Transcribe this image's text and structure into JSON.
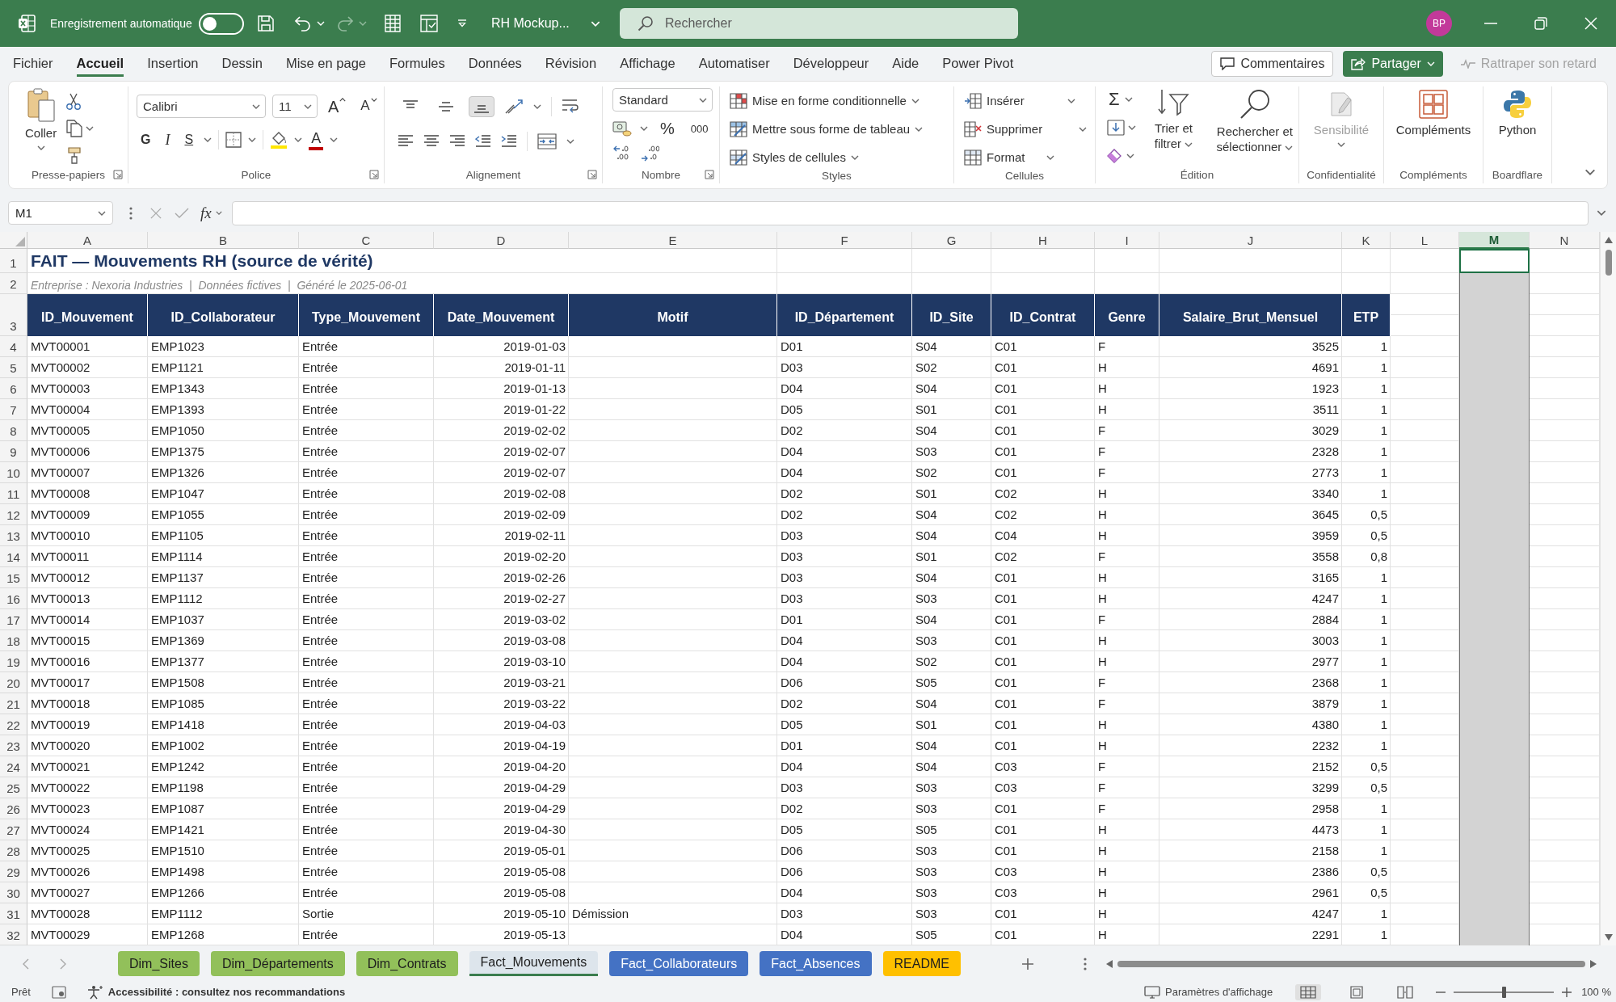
{
  "window": {
    "autosave_label": "Enregistrement automatique",
    "autosave_on": false,
    "redo_disabled": true,
    "title": "RH Mockup...",
    "search_placeholder": "Rechercher",
    "avatar": "BP"
  },
  "menu_tabs": [
    {
      "label": "Fichier",
      "selected": false
    },
    {
      "label": "Accueil",
      "selected": true
    },
    {
      "label": "Insertion",
      "selected": false
    },
    {
      "label": "Dessin",
      "selected": false
    },
    {
      "label": "Mise en page",
      "selected": false
    },
    {
      "label": "Formules",
      "selected": false
    },
    {
      "label": "Données",
      "selected": false
    },
    {
      "label": "Révision",
      "selected": false
    },
    {
      "label": "Affichage",
      "selected": false
    },
    {
      "label": "Automatiser",
      "selected": false
    },
    {
      "label": "Développeur",
      "selected": false
    },
    {
      "label": "Aide",
      "selected": false
    },
    {
      "label": "Power Pivot",
      "selected": false
    }
  ],
  "header_buttons": [
    {
      "kind": "comments",
      "label": "Commentaires",
      "disabled": false
    },
    {
      "kind": "share",
      "label": "Partager",
      "disabled": false
    },
    {
      "kind": "catchup",
      "label": "Rattraper son retard",
      "disabled": true
    }
  ],
  "ribbon": {
    "groups": [
      {
        "label": "Presse-papiers",
        "paste": "Coller"
      },
      {
        "label": "Police",
        "font": "Calibri",
        "size": "11",
        "grow": "A",
        "shrink": "A",
        "bold": "G",
        "italic": "I",
        "underline": "S",
        "font_color": "A"
      },
      {
        "label": "Alignement",
        "vertical_align": [
          {
            "kind": "top",
            "selected": false
          },
          {
            "kind": "middle",
            "selected": false
          },
          {
            "kind": "bottom",
            "selected": true
          }
        ]
      },
      {
        "label": "Nombre",
        "format": "Standard",
        "percent": "%",
        "thousands": "000"
      },
      {
        "label": "Styles",
        "items": [
          "Mise en forme conditionnelle",
          "Mettre sous forme de tableau",
          "Styles de cellules"
        ]
      },
      {
        "label": "Cellules",
        "items": [
          "Insérer",
          "Supprimer",
          "Format"
        ]
      },
      {
        "label": "Édition",
        "sum": "Σ",
        "sort": "Trier et filtrer",
        "find": "Rechercher et sélectionner"
      },
      {
        "label": "Confidentialité",
        "button": "Sensibilité",
        "disabled": true
      },
      {
        "label": "Compléments",
        "button": "Compléments"
      },
      {
        "label": "Boardflare",
        "button": "Python"
      }
    ]
  },
  "formula_bar": {
    "name_box": "M1",
    "fx": "fx"
  },
  "sheet": {
    "columns": [
      {
        "letter": "A",
        "selected": false
      },
      {
        "letter": "B",
        "selected": false
      },
      {
        "letter": "C",
        "selected": false
      },
      {
        "letter": "D",
        "selected": false
      },
      {
        "letter": "E",
        "selected": false
      },
      {
        "letter": "F",
        "selected": false
      },
      {
        "letter": "G",
        "selected": false
      },
      {
        "letter": "H",
        "selected": false
      },
      {
        "letter": "I",
        "selected": false
      },
      {
        "letter": "J",
        "selected": false
      },
      {
        "letter": "K",
        "selected": false
      },
      {
        "letter": "L",
        "selected": false
      },
      {
        "letter": "M",
        "selected": true
      },
      {
        "letter": "N",
        "selected": false
      }
    ],
    "rows": [
      {
        "number": "1",
        "kind": "title",
        "text": "FAIT — Mouvements RH (source de vérité)"
      },
      {
        "number": "2",
        "kind": "subtitle",
        "text": "Entreprise : Nexoria Industries  |  Données fictives  |  Généré le 2025-06-01"
      },
      {
        "number": "3",
        "kind": "header",
        "cells": [
          "ID_Mouvement",
          "ID_Collaborateur",
          "Type_Mouvement",
          "Date_Mouvement",
          "Motif",
          "ID_Département",
          "ID_Site",
          "ID_Contrat",
          "Genre",
          "Salaire_Brut_Mensuel",
          "ETP"
        ]
      },
      {
        "number": "4",
        "kind": "data",
        "cells": {
          "mvt": "MVT00001",
          "emp": "EMP1023",
          "type": "Entrée",
          "date": "2019-01-03",
          "dept": "D01",
          "site": "S04",
          "contrat": "C01",
          "genre": "F",
          "salaire": "3525",
          "etp": "1"
        }
      },
      {
        "number": "5",
        "kind": "data",
        "cells": {
          "mvt": "MVT00002",
          "emp": "EMP1121",
          "type": "Entrée",
          "date": "2019-01-11",
          "dept": "D03",
          "site": "S02",
          "contrat": "C01",
          "genre": "H",
          "salaire": "4691",
          "etp": "1"
        }
      },
      {
        "number": "6",
        "kind": "data",
        "cells": {
          "mvt": "MVT00003",
          "emp": "EMP1343",
          "type": "Entrée",
          "date": "2019-01-13",
          "dept": "D04",
          "site": "S04",
          "contrat": "C01",
          "genre": "H",
          "salaire": "1923",
          "etp": "1"
        }
      },
      {
        "number": "7",
        "kind": "data",
        "cells": {
          "mvt": "MVT00004",
          "emp": "EMP1393",
          "type": "Entrée",
          "date": "2019-01-22",
          "dept": "D05",
          "site": "S01",
          "contrat": "C01",
          "genre": "H",
          "salaire": "3511",
          "etp": "1"
        }
      },
      {
        "number": "8",
        "kind": "data",
        "cells": {
          "mvt": "MVT00005",
          "emp": "EMP1050",
          "type": "Entrée",
          "date": "2019-02-02",
          "dept": "D02",
          "site": "S04",
          "contrat": "C01",
          "genre": "F",
          "salaire": "3029",
          "etp": "1"
        }
      },
      {
        "number": "9",
        "kind": "data",
        "cells": {
          "mvt": "MVT00006",
          "emp": "EMP1375",
          "type": "Entrée",
          "date": "2019-02-07",
          "dept": "D04",
          "site": "S03",
          "contrat": "C01",
          "genre": "F",
          "salaire": "2328",
          "etp": "1"
        }
      },
      {
        "number": "10",
        "kind": "data",
        "cells": {
          "mvt": "MVT00007",
          "emp": "EMP1326",
          "type": "Entrée",
          "date": "2019-02-07",
          "dept": "D04",
          "site": "S02",
          "contrat": "C01",
          "genre": "F",
          "salaire": "2773",
          "etp": "1"
        }
      },
      {
        "number": "11",
        "kind": "data",
        "cells": {
          "mvt": "MVT00008",
          "emp": "EMP1047",
          "type": "Entrée",
          "date": "2019-02-08",
          "dept": "D02",
          "site": "S01",
          "contrat": "C02",
          "genre": "H",
          "salaire": "3340",
          "etp": "1"
        }
      },
      {
        "number": "12",
        "kind": "data",
        "cells": {
          "mvt": "MVT00009",
          "emp": "EMP1055",
          "type": "Entrée",
          "date": "2019-02-09",
          "dept": "D02",
          "site": "S04",
          "contrat": "C02",
          "genre": "H",
          "salaire": "3645",
          "etp": "0,5"
        }
      },
      {
        "number": "13",
        "kind": "data",
        "cells": {
          "mvt": "MVT00010",
          "emp": "EMP1105",
          "type": "Entrée",
          "date": "2019-02-11",
          "dept": "D03",
          "site": "S04",
          "contrat": "C04",
          "genre": "H",
          "salaire": "3959",
          "etp": "0,5"
        }
      },
      {
        "number": "14",
        "kind": "data",
        "cells": {
          "mvt": "MVT00011",
          "emp": "EMP1114",
          "type": "Entrée",
          "date": "2019-02-20",
          "dept": "D03",
          "site": "S01",
          "contrat": "C02",
          "genre": "F",
          "salaire": "3558",
          "etp": "0,8"
        }
      },
      {
        "number": "15",
        "kind": "data",
        "cells": {
          "mvt": "MVT00012",
          "emp": "EMP1137",
          "type": "Entrée",
          "date": "2019-02-26",
          "dept": "D03",
          "site": "S04",
          "contrat": "C01",
          "genre": "H",
          "salaire": "3165",
          "etp": "1"
        }
      },
      {
        "number": "16",
        "kind": "data",
        "cells": {
          "mvt": "MVT00013",
          "emp": "EMP1112",
          "type": "Entrée",
          "date": "2019-02-27",
          "dept": "D03",
          "site": "S03",
          "contrat": "C01",
          "genre": "H",
          "salaire": "4247",
          "etp": "1"
        }
      },
      {
        "number": "17",
        "kind": "data",
        "cells": {
          "mvt": "MVT00014",
          "emp": "EMP1037",
          "type": "Entrée",
          "date": "2019-03-02",
          "dept": "D01",
          "site": "S04",
          "contrat": "C01",
          "genre": "F",
          "salaire": "2884",
          "etp": "1"
        }
      },
      {
        "number": "18",
        "kind": "data",
        "cells": {
          "mvt": "MVT00015",
          "emp": "EMP1369",
          "type": "Entrée",
          "date": "2019-03-08",
          "dept": "D04",
          "site": "S03",
          "contrat": "C01",
          "genre": "H",
          "salaire": "3003",
          "etp": "1"
        }
      },
      {
        "number": "19",
        "kind": "data",
        "cells": {
          "mvt": "MVT00016",
          "emp": "EMP1377",
          "type": "Entrée",
          "date": "2019-03-10",
          "dept": "D04",
          "site": "S02",
          "contrat": "C01",
          "genre": "H",
          "salaire": "2977",
          "etp": "1"
        }
      },
      {
        "number": "20",
        "kind": "data",
        "cells": {
          "mvt": "MVT00017",
          "emp": "EMP1508",
          "type": "Entrée",
          "date": "2019-03-21",
          "dept": "D06",
          "site": "S05",
          "contrat": "C01",
          "genre": "F",
          "salaire": "2368",
          "etp": "1"
        }
      },
      {
        "number": "21",
        "kind": "data",
        "cells": {
          "mvt": "MVT00018",
          "emp": "EMP1085",
          "type": "Entrée",
          "date": "2019-03-22",
          "dept": "D02",
          "site": "S04",
          "contrat": "C01",
          "genre": "F",
          "salaire": "3879",
          "etp": "1"
        }
      },
      {
        "number": "22",
        "kind": "data",
        "cells": {
          "mvt": "MVT00019",
          "emp": "EMP1418",
          "type": "Entrée",
          "date": "2019-04-03",
          "dept": "D05",
          "site": "S01",
          "contrat": "C01",
          "genre": "H",
          "salaire": "4380",
          "etp": "1"
        }
      },
      {
        "number": "23",
        "kind": "data",
        "cells": {
          "mvt": "MVT00020",
          "emp": "EMP1002",
          "type": "Entrée",
          "date": "2019-04-19",
          "dept": "D01",
          "site": "S04",
          "contrat": "C01",
          "genre": "H",
          "salaire": "2232",
          "etp": "1"
        }
      },
      {
        "number": "24",
        "kind": "data",
        "cells": {
          "mvt": "MVT00021",
          "emp": "EMP1242",
          "type": "Entrée",
          "date": "2019-04-20",
          "dept": "D04",
          "site": "S04",
          "contrat": "C03",
          "genre": "F",
          "salaire": "2152",
          "etp": "0,5"
        }
      },
      {
        "number": "25",
        "kind": "data",
        "cells": {
          "mvt": "MVT00022",
          "emp": "EMP1198",
          "type": "Entrée",
          "date": "2019-04-29",
          "dept": "D03",
          "site": "S03",
          "contrat": "C03",
          "genre": "F",
          "salaire": "3299",
          "etp": "0,5"
        }
      },
      {
        "number": "26",
        "kind": "data",
        "cells": {
          "mvt": "MVT00023",
          "emp": "EMP1087",
          "type": "Entrée",
          "date": "2019-04-29",
          "dept": "D02",
          "site": "S03",
          "contrat": "C01",
          "genre": "F",
          "salaire": "2958",
          "etp": "1"
        }
      },
      {
        "number": "27",
        "kind": "data",
        "cells": {
          "mvt": "MVT00024",
          "emp": "EMP1421",
          "type": "Entrée",
          "date": "2019-04-30",
          "dept": "D05",
          "site": "S05",
          "contrat": "C01",
          "genre": "H",
          "salaire": "4473",
          "etp": "1"
        }
      },
      {
        "number": "28",
        "kind": "data",
        "cells": {
          "mvt": "MVT00025",
          "emp": "EMP1510",
          "type": "Entrée",
          "date": "2019-05-01",
          "dept": "D06",
          "site": "S03",
          "contrat": "C01",
          "genre": "H",
          "salaire": "2158",
          "etp": "1"
        }
      },
      {
        "number": "29",
        "kind": "data",
        "cells": {
          "mvt": "MVT00026",
          "emp": "EMP1498",
          "type": "Entrée",
          "date": "2019-05-08",
          "dept": "D06",
          "site": "S03",
          "contrat": "C03",
          "genre": "H",
          "salaire": "2386",
          "etp": "0,5"
        }
      },
      {
        "number": "30",
        "kind": "data",
        "cells": {
          "mvt": "MVT00027",
          "emp": "EMP1266",
          "type": "Entrée",
          "date": "2019-05-08",
          "dept": "D04",
          "site": "S03",
          "contrat": "C03",
          "genre": "H",
          "salaire": "2961",
          "etp": "0,5"
        }
      },
      {
        "number": "31",
        "kind": "data",
        "cells": {
          "mvt": "MVT00028",
          "emp": "EMP1112",
          "type": "Sortie",
          "date": "2019-05-10",
          "motif": "Démission",
          "dept": "D03",
          "site": "S03",
          "contrat": "C01",
          "genre": "H",
          "salaire": "4247",
          "etp": "1"
        }
      },
      {
        "number": "32",
        "kind": "data",
        "cells": {
          "mvt": "MVT00029",
          "emp": "EMP1268",
          "type": "Entrée",
          "date": "2019-05-13",
          "dept": "D04",
          "site": "S05",
          "contrat": "C01",
          "genre": "H",
          "salaire": "2291",
          "etp": "1"
        }
      }
    ]
  },
  "sheet_tabs": [
    {
      "label": "Dim_Sites",
      "selected": false,
      "color": "#92c05a"
    },
    {
      "label": "Dim_Départements",
      "selected": false,
      "color": "#92c05a"
    },
    {
      "label": "Dim_Contrats",
      "selected": false,
      "color": "#92c05a"
    },
    {
      "label": "Fact_Mouvements",
      "selected": true
    },
    {
      "label": "Fact_Collaborateurs",
      "selected": false,
      "color": "#4472c4"
    },
    {
      "label": "Fact_Absences",
      "selected": false,
      "color": "#4472c4"
    },
    {
      "label": "README",
      "selected": false,
      "color": "#ffc000"
    }
  ],
  "status_bar": {
    "ready": "Prêt",
    "accessibility": "Accessibilité : consultez nos recommandations",
    "display_settings": "Paramètres d'affichage",
    "views": [
      {
        "kind": "normal",
        "selected": true
      },
      {
        "kind": "layout",
        "selected": false
      },
      {
        "kind": "breaks",
        "selected": false
      }
    ],
    "zoom": {
      "level": 0.5,
      "reading": "100 %"
    }
  }
}
